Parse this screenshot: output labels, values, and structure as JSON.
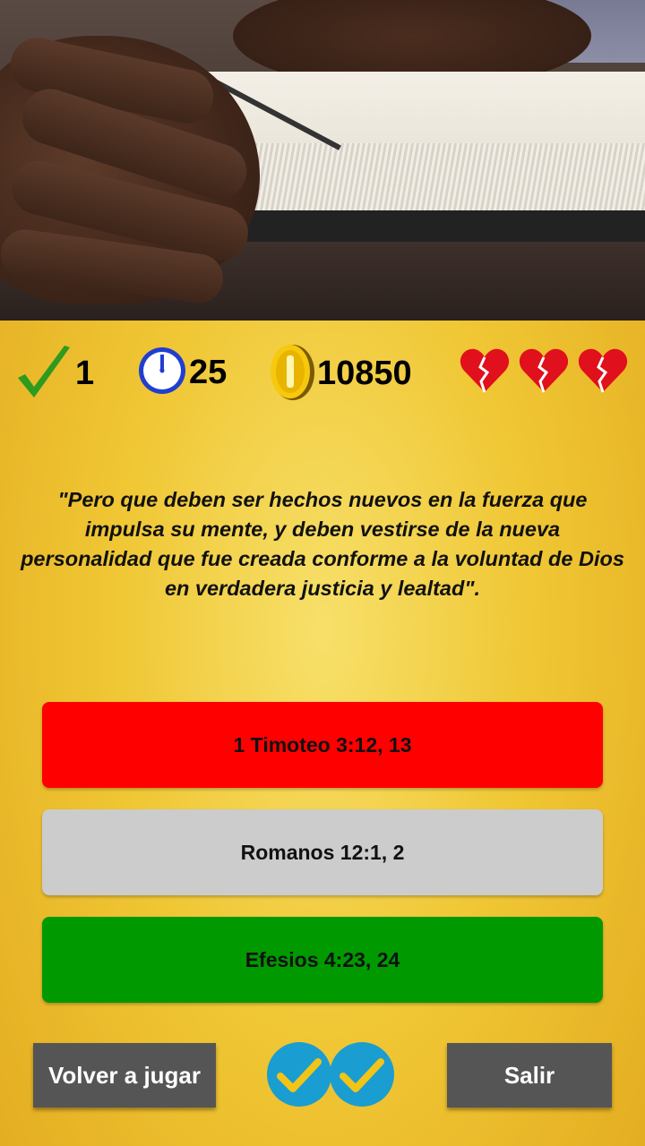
{
  "stats": {
    "correct_count": "1",
    "timer_seconds": "25",
    "coins": "10850",
    "lives_icons": [
      "broken-heart-icon",
      "broken-heart-icon",
      "broken-heart-icon"
    ]
  },
  "question": {
    "verse": "\"Pero que deben ser hechos nuevos en la fuerza que impulsa su mente, y deben vestirse de la nueva personalidad que fue creada conforme a la voluntad de Dios en verdadera justicia y lealtad\"."
  },
  "answers": [
    {
      "label": "1 Timoteo 3:12, 13",
      "state": "wrong",
      "color": "#ff0000"
    },
    {
      "label": "Romanos 12:1, 2",
      "state": "neutral",
      "color": "#cccccc"
    },
    {
      "label": "Efesios 4:23, 24",
      "state": "correct",
      "color": "#009a00"
    }
  ],
  "footer": {
    "replay_label": "Volver a jugar",
    "exit_label": "Salir",
    "badge_icons": [
      "check-badge-icon",
      "check-badge-icon"
    ]
  },
  "colors": {
    "accent_blue": "#1a9dd1",
    "check_green": "#2e9a1f",
    "heart_red": "#e0101c",
    "button_gray": "#555555"
  }
}
